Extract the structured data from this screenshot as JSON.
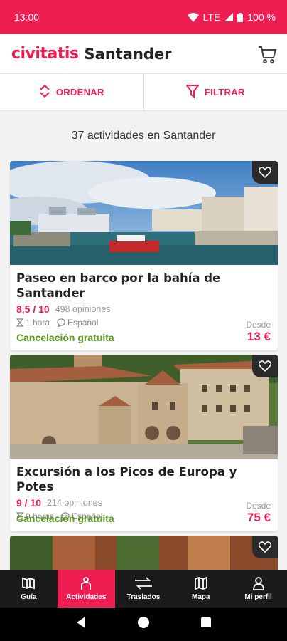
{
  "status_bar": {
    "time": "13:00",
    "network": "LTE",
    "battery": "100 %"
  },
  "header": {
    "logo": "civitatis",
    "city": "Santander",
    "cart_icon": "cart-icon"
  },
  "actions": {
    "sort_label": "ORDENAR",
    "filter_label": "FILTRAR"
  },
  "results": {
    "count_text": "37 actividades en Santander"
  },
  "colors": {
    "brand": "#ee1d52",
    "success": "#5a9a1e",
    "nav_bg": "#1b1b1b"
  },
  "cards": [
    {
      "title": "Paseo en barco por la bahía de Santander",
      "rating": "8,5 / 10",
      "reviews": "498 opiniones",
      "duration": "1 hora",
      "language": "Español",
      "cancellation": "Cancelación gratuita",
      "price_from": "Desde",
      "price": "13 €"
    },
    {
      "title": "Excursión a los Picos de Europa y Potes",
      "rating": "9 / 10",
      "reviews": "214 opiniones",
      "duration": "9 horas",
      "language": "Español",
      "cancellation": "Cancelación gratuita",
      "price_from": "Desde",
      "price": "75 €"
    }
  ],
  "bottom_nav": [
    {
      "label": "Guía",
      "icon": "book-icon"
    },
    {
      "label": "Actividades",
      "icon": "person-icon",
      "active": true
    },
    {
      "label": "Traslados",
      "icon": "transfer-icon"
    },
    {
      "label": "Mapa",
      "icon": "map-icon"
    },
    {
      "label": "Mi perfil",
      "icon": "profile-icon"
    }
  ]
}
